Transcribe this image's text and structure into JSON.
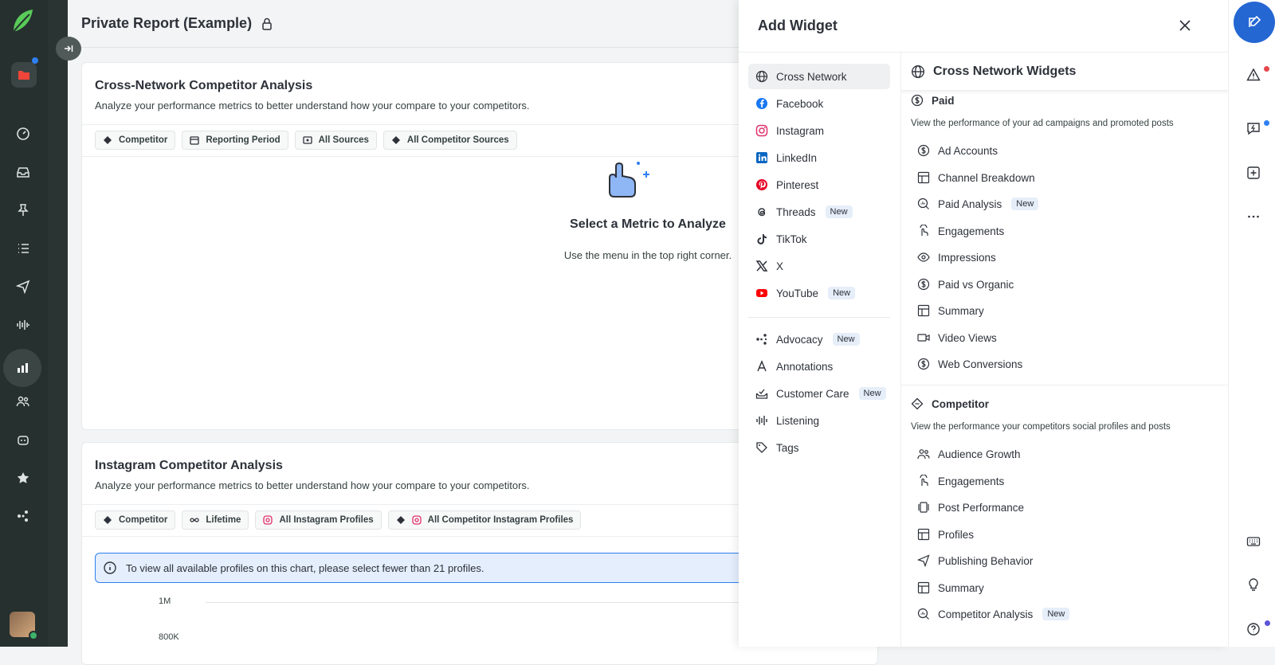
{
  "header": {
    "title": "Private Report (Example)"
  },
  "card1": {
    "title": "Cross-Network Competitor Analysis",
    "subtitle": "Analyze your performance metrics to better understand how your compare to your competitors.",
    "pills": [
      "Competitor",
      "Reporting Period",
      "All Sources",
      "All Competitor Sources"
    ],
    "empty_title": "Select a Metric to Analyze",
    "empty_desc": "Use the menu in the top right corner."
  },
  "card2": {
    "title": "Instagram Competitor Analysis",
    "subtitle": "Analyze your performance metrics to better understand how your compare to your competitors.",
    "pills": [
      "Competitor",
      "Lifetime",
      "All Instagram Profiles",
      "All Competitor Instagram Profiles"
    ],
    "banner": "To view all available profiles on this chart, please select fewer than 21 profiles.",
    "axis": [
      "1M",
      "800K"
    ]
  },
  "panel": {
    "title": "Add Widget",
    "nav": [
      {
        "label": "Cross Network",
        "badge": ""
      },
      {
        "label": "Facebook",
        "badge": ""
      },
      {
        "label": "Instagram",
        "badge": ""
      },
      {
        "label": "LinkedIn",
        "badge": ""
      },
      {
        "label": "Pinterest",
        "badge": ""
      },
      {
        "label": "Threads",
        "badge": "New"
      },
      {
        "label": "TikTok",
        "badge": ""
      },
      {
        "label": "X",
        "badge": ""
      },
      {
        "label": "YouTube",
        "badge": "New"
      },
      {
        "label": "Advocacy",
        "badge": "New"
      },
      {
        "label": "Annotations",
        "badge": ""
      },
      {
        "label": "Customer Care",
        "badge": "New"
      },
      {
        "label": "Listening",
        "badge": ""
      },
      {
        "label": "Tags",
        "badge": ""
      }
    ],
    "content_title": "Cross Network Widgets",
    "paid": {
      "title": "Paid",
      "desc": "View the performance of your ad campaigns and promoted posts",
      "items": [
        {
          "label": "Ad Accounts",
          "badge": ""
        },
        {
          "label": "Channel Breakdown",
          "badge": ""
        },
        {
          "label": "Paid Analysis",
          "badge": "New"
        },
        {
          "label": "Engagements",
          "badge": ""
        },
        {
          "label": "Impressions",
          "badge": ""
        },
        {
          "label": "Paid vs Organic",
          "badge": ""
        },
        {
          "label": "Summary",
          "badge": ""
        },
        {
          "label": "Video Views",
          "badge": ""
        },
        {
          "label": "Web Conversions",
          "badge": ""
        }
      ]
    },
    "competitor": {
      "title": "Competitor",
      "desc": "View the performance your competitors social profiles and posts",
      "items": [
        {
          "label": "Audience Growth",
          "badge": ""
        },
        {
          "label": "Engagements",
          "badge": ""
        },
        {
          "label": "Post Performance",
          "badge": ""
        },
        {
          "label": "Profiles",
          "badge": ""
        },
        {
          "label": "Publishing Behavior",
          "badge": ""
        },
        {
          "label": "Summary",
          "badge": ""
        },
        {
          "label": "Competitor Analysis",
          "badge": "New"
        }
      ]
    }
  },
  "colors": {
    "rail": "#26302f",
    "accent": "#2467d3",
    "brand_green": "#3db26b",
    "alert_red": "#e5484d"
  }
}
